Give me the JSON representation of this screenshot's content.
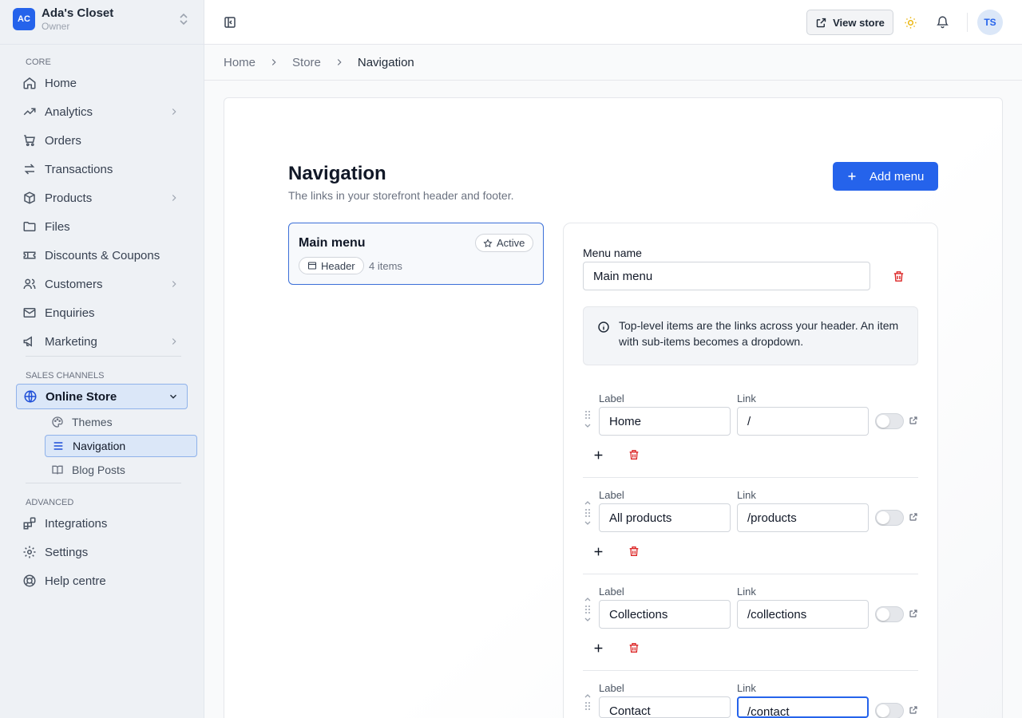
{
  "brand": {
    "initials": "AC",
    "name": "Ada's Closet",
    "role": "Owner"
  },
  "sidebar": {
    "sections": {
      "core": "CORE",
      "sales": "SALES CHANNELS",
      "advanced": "ADVANCED"
    },
    "core_items": [
      "Home",
      "Analytics",
      "Orders",
      "Transactions",
      "Products",
      "Files",
      "Discounts & Coupons",
      "Customers",
      "Enquiries",
      "Marketing"
    ],
    "channel": "Online Store",
    "channel_items": [
      "Themes",
      "Navigation",
      "Blog Posts"
    ],
    "advanced_items": [
      "Integrations",
      "Settings",
      "Help centre"
    ]
  },
  "topbar": {
    "view_store": "View store",
    "avatar": "TS"
  },
  "breadcrumb": [
    "Home",
    "Store",
    "Navigation"
  ],
  "page": {
    "title": "Navigation",
    "subtitle": "The links in your storefront header and footer.",
    "add_menu": "Add menu"
  },
  "menu_card": {
    "name": "Main menu",
    "status": "Active",
    "location": "Header",
    "count": "4 items"
  },
  "editor": {
    "menu_name_label": "Menu name",
    "menu_name_value": "Main menu",
    "info": "Top-level items are the links across your header. An item with sub-items becomes a dropdown.",
    "label_header": "Label",
    "link_header": "Link",
    "items": [
      {
        "label": "Home",
        "link": "/"
      },
      {
        "label": "All products",
        "link": "/products"
      },
      {
        "label": "Collections",
        "link": "/collections"
      },
      {
        "label": "Contact",
        "link": "/contact"
      }
    ]
  },
  "colors": {
    "accent": "#2563eb",
    "danger": "#dc2626",
    "sidebar_bg": "#eef1f5"
  }
}
